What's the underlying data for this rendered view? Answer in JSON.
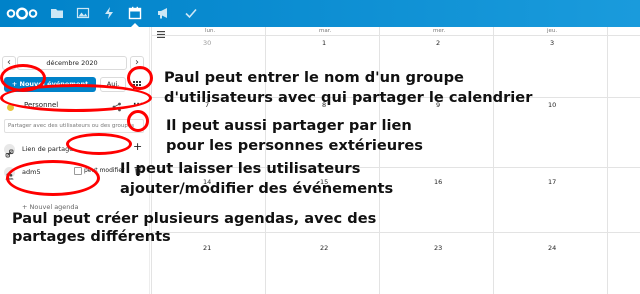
{
  "header": {
    "apps": [
      {
        "icon": "folder-icon"
      },
      {
        "icon": "image-icon"
      },
      {
        "icon": "activity-icon"
      },
      {
        "icon": "calendar-icon"
      },
      {
        "icon": "megaphone-icon"
      },
      {
        "icon": "checkmark-icon"
      }
    ],
    "active_app": "calendar",
    "bar_color": "#0082c9"
  },
  "sidebar": {
    "month_label": "décembre 2020",
    "prev_label": "‹",
    "next_label": "›",
    "new_event_label": "+ Nouvel événement",
    "today_label": "Auj.",
    "calendar": {
      "name": "Personnel",
      "color": "#e9c43a",
      "more_label": "···"
    },
    "share_placeholder": "Partager avec des utilisateurs ou des groupes",
    "link_label": "Lien de partage",
    "add_label": "+",
    "share_user": "adm5",
    "permission_label": "peut modifier",
    "new_agenda_label": "+ Nouvel agenda"
  },
  "calendar_view": {
    "day_headers": [
      "lun.",
      "mar.",
      "mer.",
      "jeu."
    ],
    "weeks": [
      [
        "30",
        "1",
        "2",
        "3"
      ],
      [
        "7",
        "8",
        "9",
        "10"
      ],
      [
        "14",
        "15",
        "16",
        "17"
      ],
      [
        "21",
        "22",
        "23",
        "24"
      ]
    ],
    "other_month": [
      "30"
    ]
  },
  "annotations": {
    "caption_1": "Paul peut entrer le nom d'un groupe\nd'utilisateurs avec qui partager le calendrier",
    "caption_2": "Il peut aussi partager par lien\npour les personnes extérieures",
    "caption_3": "Il peut laisser les utilisateurs\najouter/modifier des événements",
    "caption_4": "Paul peut créer plusieurs agendas, avec des\npartages différents",
    "highlight_color": "#ff0000"
  }
}
